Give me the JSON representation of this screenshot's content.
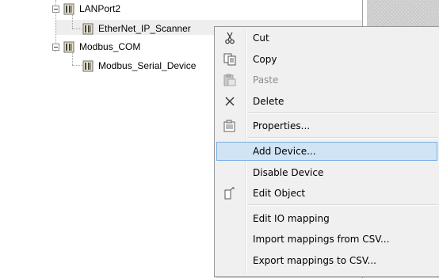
{
  "tree": {
    "nodes": [
      {
        "label": "LANPort2"
      },
      {
        "label": "EtherNet_IP_Scanner"
      },
      {
        "label": "Modbus_COM"
      },
      {
        "label": "Modbus_Serial_Device"
      }
    ]
  },
  "context_menu": {
    "items": [
      {
        "label": "Cut",
        "icon": "scissors-icon"
      },
      {
        "label": "Copy",
        "icon": "copy-icon"
      },
      {
        "label": "Paste",
        "icon": "paste-icon",
        "disabled": true
      },
      {
        "label": "Delete",
        "icon": "delete-x-icon"
      },
      {
        "label": "Properties...",
        "icon": "properties-icon"
      },
      {
        "label": "Add Device...",
        "highlighted": true
      },
      {
        "label": "Disable Device"
      },
      {
        "label": "Edit Object",
        "icon": "edit-object-icon"
      },
      {
        "label": "Edit IO mapping"
      },
      {
        "label": "Import mappings from CSV..."
      },
      {
        "label": "Export mappings to CSV..."
      }
    ]
  },
  "colors": {
    "highlight_bg": "#d1e4f6",
    "highlight_border": "#78aee5",
    "menu_bg": "#f0f0f0",
    "disabled_text": "#8d8d8d"
  }
}
